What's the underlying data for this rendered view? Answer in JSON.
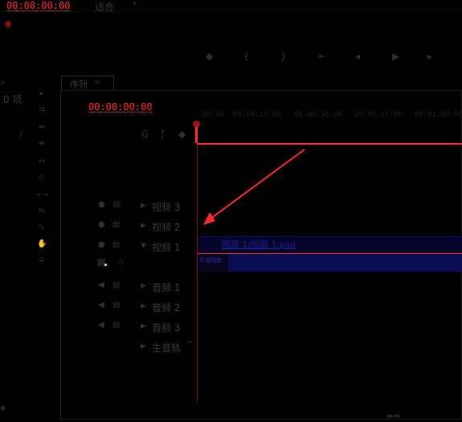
{
  "top": {
    "timecode": "00:00:00:00",
    "fit_label": "适合"
  },
  "left_panel": {
    "item_count_label": "0 项"
  },
  "sequence_panel": {
    "tab_label": "序列",
    "tab_menu_glyph": "≡",
    "timecode": "00:00:00:00",
    "ruler_ticks": [
      "00:00",
      "00:00:15:00",
      "00:00:30:00",
      "00:00:45:00",
      "00:01:00:00"
    ]
  },
  "tracks": {
    "video": [
      {
        "label": "视频 3"
      },
      {
        "label": "视频 2"
      },
      {
        "label": "视频 1"
      }
    ],
    "audio": [
      {
        "label": "音频 1"
      },
      {
        "label": "音频 2"
      },
      {
        "label": "音频 3"
      }
    ],
    "master": {
      "label": "主音轨"
    }
  },
  "clip": {
    "title": "图层 1/图层 1.psd",
    "sub": "不透明度"
  },
  "colors": {
    "accent_red": "#ff2a2a",
    "clip_blue": "#0a0a55",
    "clip_border": "#14148a"
  }
}
